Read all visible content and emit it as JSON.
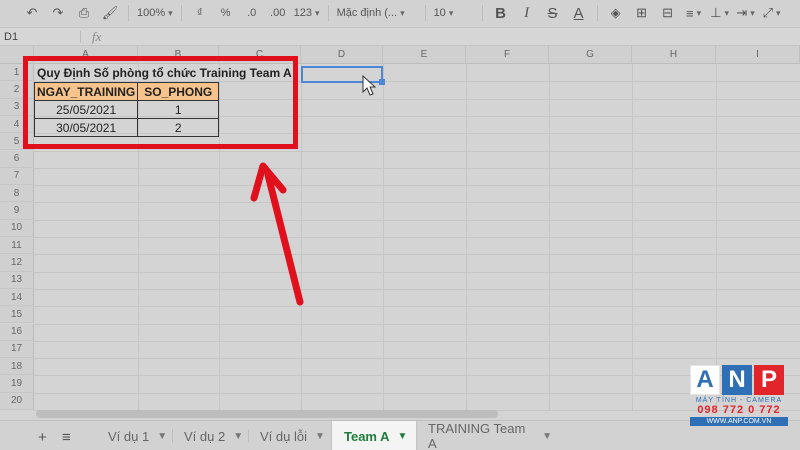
{
  "toolbar": {
    "zoom": "100%",
    "currency": "₫",
    "percent": "%",
    "dec_less": ".0",
    "dec_more": ".00",
    "format_more": "123",
    "font": "Mặc định (...",
    "font_size": "10",
    "bold": "B",
    "italic": "I",
    "strike": "S",
    "text_color": "A"
  },
  "formula_bar": {
    "cell_ref": "D1",
    "fx": "fx"
  },
  "columns": [
    "A",
    "B",
    "C",
    "D",
    "E",
    "F",
    "G",
    "H",
    "I"
  ],
  "rows": [
    "1",
    "2",
    "3",
    "4",
    "5",
    "6",
    "7",
    "8",
    "9",
    "10",
    "11",
    "12",
    "13",
    "14",
    "15",
    "16",
    "17",
    "18",
    "19",
    "20"
  ],
  "sheet": {
    "title": "Quy Định Số phòng tổ chức Training Team A",
    "headers": [
      "NGAY_TRAINING",
      "SO_PHONG"
    ],
    "data": [
      [
        "25/05/2021",
        "1"
      ],
      [
        "30/05/2021",
        "2"
      ]
    ]
  },
  "tabs": [
    {
      "label": "Ví dụ 1",
      "active": false
    },
    {
      "label": "Ví dụ 2",
      "active": false
    },
    {
      "label": "Ví dụ lỗi",
      "active": false
    },
    {
      "label": "Team A",
      "active": true
    },
    {
      "label": "TRAINING Team A",
      "active": false
    }
  ],
  "colors": {
    "highlight_box": "#e0101c",
    "header_fill": "#f6c38c",
    "active_tab_text": "#1e7d3c",
    "selection": "#4a87d8"
  },
  "logo": {
    "letters": [
      "A",
      "N",
      "P"
    ],
    "tagline": "MÁY TÍNH - CAMERA",
    "phone": "098 772 0 772",
    "website": "WWW.ANP.COM.VN"
  }
}
